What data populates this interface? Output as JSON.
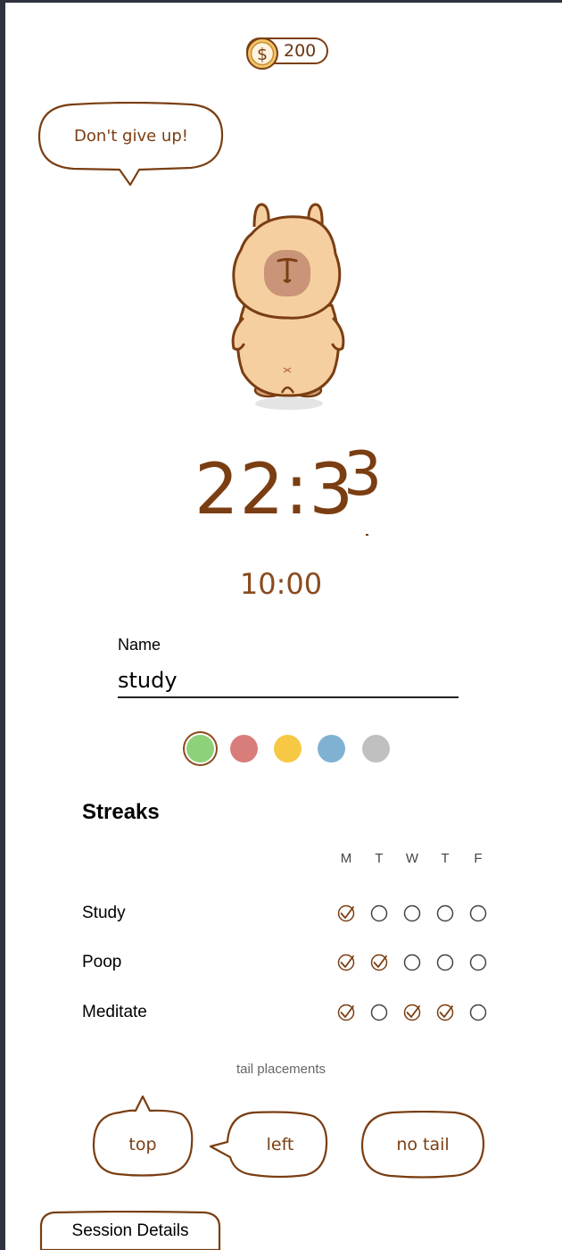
{
  "coins": {
    "count": "200",
    "icon": "dollar-coin-icon",
    "symbol": "$"
  },
  "speech_bubble": {
    "text": "Don't give up!"
  },
  "timer": {
    "elapsed_main": "22:3",
    "elapsed_sup": "3",
    "target": "10:00"
  },
  "name_field": {
    "label": "Name",
    "value": "study"
  },
  "color_swatches": [
    {
      "color": "#8dd17a",
      "selected": true
    },
    {
      "color": "#d97d7b",
      "selected": false
    },
    {
      "color": "#f6c844",
      "selected": false
    },
    {
      "color": "#7fb2d2",
      "selected": false
    },
    {
      "color": "#c0c0c0",
      "selected": false
    }
  ],
  "streaks": {
    "title": "Streaks",
    "days": [
      "M",
      "T",
      "W",
      "T",
      "F"
    ],
    "habits": [
      {
        "name": "Study",
        "done": [
          true,
          false,
          false,
          false,
          false
        ]
      },
      {
        "name": "Poop",
        "done": [
          true,
          true,
          false,
          false,
          false
        ]
      },
      {
        "name": "Meditate",
        "done": [
          true,
          false,
          true,
          true,
          false
        ]
      }
    ]
  },
  "tail_placements": {
    "caption": "tail placements",
    "options": [
      {
        "label": "top"
      },
      {
        "label": "left"
      },
      {
        "label": "no tail"
      }
    ]
  },
  "session_details": {
    "label": "Session Details"
  },
  "colors": {
    "brown": "#7a3e12",
    "mascot_fill": "#f6cfa0",
    "snout": "#c99478"
  }
}
